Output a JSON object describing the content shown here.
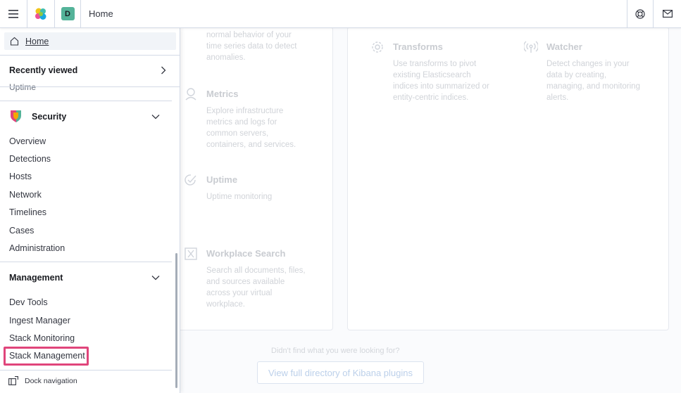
{
  "header": {
    "breadcrumb": "Home",
    "space_initial": "D",
    "icons": [
      "menu-icon",
      "elastic-logo",
      "help-icon",
      "mail-icon"
    ]
  },
  "nav": {
    "home_label": "Home",
    "recently_viewed": {
      "title": "Recently viewed",
      "partial_item": "Uptime"
    },
    "security": {
      "title": "Security",
      "items": [
        "Overview",
        "Detections",
        "Hosts",
        "Network",
        "Timelines",
        "Cases",
        "Administration"
      ]
    },
    "management": {
      "title": "Management",
      "items": [
        "Dev Tools",
        "Ingest Manager",
        "Stack Monitoring",
        "Stack Management"
      ]
    },
    "dock_label": "Dock navigation"
  },
  "content": {
    "partial_desc": [
      "normal behavior of your",
      "time series data to detect",
      "anomalies."
    ],
    "cards": [
      {
        "title": "Metrics",
        "icon": "metrics-icon",
        "desc": [
          "Explore infrastructure",
          "metrics and logs for",
          "common servers,",
          "containers, and services."
        ]
      },
      {
        "title": "Uptime",
        "icon": "uptime-icon",
        "desc": [
          "Uptime monitoring"
        ]
      },
      {
        "title": "Workplace Search",
        "icon": "workplace-search-icon",
        "desc": [
          "Search all documents, files,",
          "and sources available",
          "across your virtual",
          "workplace."
        ]
      },
      {
        "title": "Transforms",
        "icon": "gear-icon",
        "desc": [
          "Use transforms to pivot",
          "existing Elasticsearch",
          "indices into summarized or",
          "entity-centric indices."
        ]
      },
      {
        "title": "Watcher",
        "icon": "watcher-icon",
        "desc": [
          "Detect changes in your",
          "data by creating,",
          "managing, and monitoring",
          "alerts."
        ]
      }
    ],
    "not_found": "Didn't find what you were looking for?",
    "view_all_button": "View full directory of Kibana plugins"
  },
  "colors": {
    "highlight": "#e0457b",
    "space_avatar": "#54b399",
    "security_logo": [
      "#e0457b",
      "#54b399",
      "#f5a700"
    ]
  }
}
